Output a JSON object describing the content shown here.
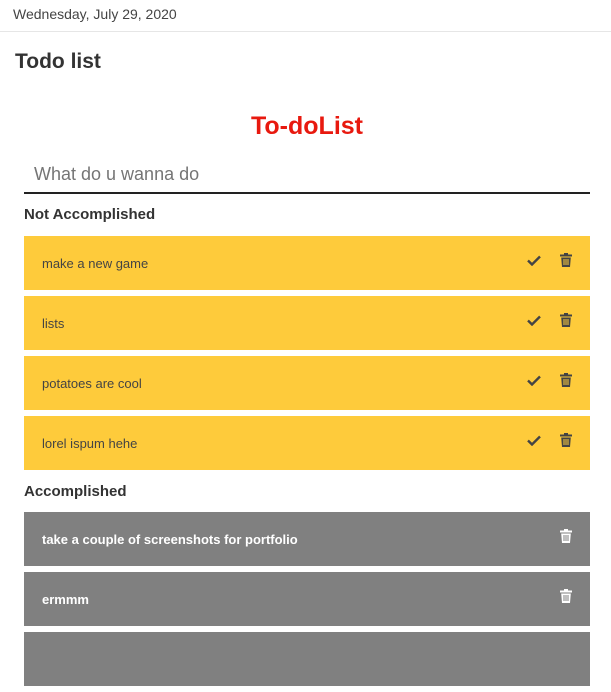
{
  "header": {
    "date": "Wednesday, July 29, 2020"
  },
  "page": {
    "heading": "Todo list"
  },
  "app": {
    "title": "To-doList",
    "input": {
      "placeholder": "What do u wanna do",
      "value": ""
    },
    "sections": {
      "not_accomplished": {
        "label": "Not Accomplished",
        "items": [
          {
            "text": "make a new game"
          },
          {
            "text": "lists"
          },
          {
            "text": "potatoes are cool"
          },
          {
            "text": "lorel ispum hehe"
          }
        ]
      },
      "accomplished": {
        "label": "Accomplished",
        "items": [
          {
            "text": "take a couple of screenshots for portfolio"
          },
          {
            "text": "ermmm"
          },
          {
            "text": ""
          }
        ]
      }
    },
    "icons": {
      "complete": "check-icon",
      "delete": "trash-icon"
    }
  },
  "colors": {
    "title": "#e8190f",
    "pending_bg": "#fecb3b",
    "done_bg": "#808080",
    "icon_dark": "#444444",
    "icon_light": "#ffffff"
  }
}
